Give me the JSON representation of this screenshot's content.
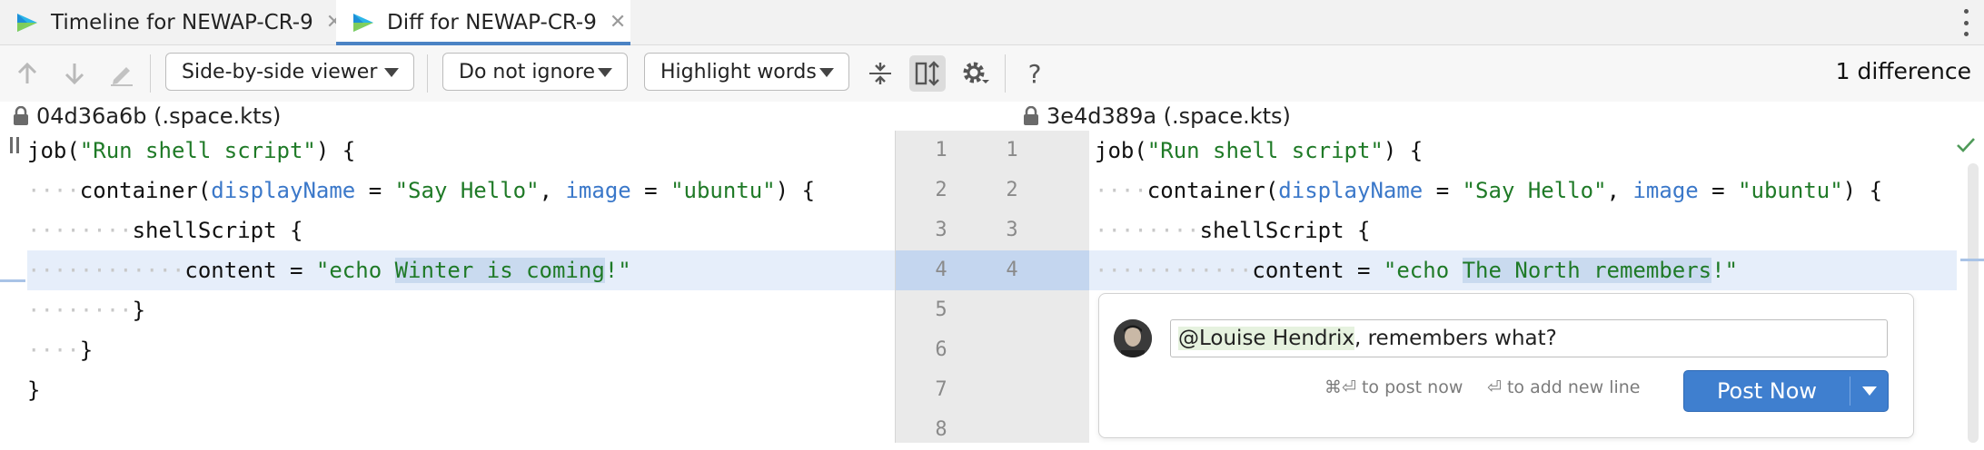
{
  "tabs": [
    {
      "label": "Timeline for NEWAP-CR-9",
      "active": false
    },
    {
      "label": "Diff for NEWAP-CR-9",
      "active": true
    }
  ],
  "toolbar": {
    "viewer_mode": "Side-by-side viewer",
    "ignore_mode": "Do not ignore",
    "highlight_mode": "Highlight words",
    "help_label": "?",
    "difference_count": "1 difference",
    "icons": [
      "arrow-up-icon",
      "arrow-down-icon",
      "edit-icon",
      "collapse-unchanged-icon",
      "sync-scroll-icon",
      "gear-icon",
      "help-icon"
    ]
  },
  "left_pane": {
    "file_label": "04d36a6b (.space.kts)",
    "lines": [
      {
        "indent": "",
        "tokens": [
          {
            "t": "job(",
            "c": ""
          },
          {
            "t": "\"Run shell script\"",
            "c": "str"
          },
          {
            "t": ") {",
            "c": ""
          }
        ]
      },
      {
        "indent": "····",
        "tokens": [
          {
            "t": "container(",
            "c": ""
          },
          {
            "t": "displayName",
            "c": "key"
          },
          {
            "t": " = ",
            "c": ""
          },
          {
            "t": "\"Say Hello\"",
            "c": "str"
          },
          {
            "t": ", ",
            "c": ""
          },
          {
            "t": "image",
            "c": "key"
          },
          {
            "t": " = ",
            "c": ""
          },
          {
            "t": "\"ubuntu\"",
            "c": "str"
          },
          {
            "t": ") {",
            "c": ""
          }
        ]
      },
      {
        "indent": "········",
        "tokens": [
          {
            "t": "shellScript {",
            "c": ""
          }
        ]
      },
      {
        "indent": "············",
        "tokens": [
          {
            "t": "content = ",
            "c": ""
          },
          {
            "t": "\"echo ",
            "c": "str"
          },
          {
            "t": "Winter is coming",
            "c": "str hl"
          },
          {
            "t": "!\"",
            "c": "str"
          }
        ],
        "changed": true
      },
      {
        "indent": "········",
        "tokens": [
          {
            "t": "}",
            "c": ""
          }
        ]
      },
      {
        "indent": "····",
        "tokens": [
          {
            "t": "}",
            "c": ""
          }
        ]
      },
      {
        "indent": "",
        "tokens": [
          {
            "t": "}",
            "c": ""
          }
        ]
      }
    ]
  },
  "right_pane": {
    "file_label": "3e4d389a (.space.kts)",
    "lines": [
      {
        "indent": "",
        "tokens": [
          {
            "t": "job(",
            "c": ""
          },
          {
            "t": "\"Run shell script\"",
            "c": "str"
          },
          {
            "t": ") {",
            "c": ""
          }
        ]
      },
      {
        "indent": "····",
        "tokens": [
          {
            "t": "container(",
            "c": ""
          },
          {
            "t": "displayName",
            "c": "key"
          },
          {
            "t": " = ",
            "c": ""
          },
          {
            "t": "\"Say Hello\"",
            "c": "str"
          },
          {
            "t": ", ",
            "c": ""
          },
          {
            "t": "image",
            "c": "key"
          },
          {
            "t": " = ",
            "c": ""
          },
          {
            "t": "\"ubuntu\"",
            "c": "str"
          },
          {
            "t": ") {",
            "c": ""
          }
        ]
      },
      {
        "indent": "········",
        "tokens": [
          {
            "t": "shellScript {",
            "c": ""
          }
        ]
      },
      {
        "indent": "············",
        "tokens": [
          {
            "t": "content = ",
            "c": ""
          },
          {
            "t": "\"echo ",
            "c": "str"
          },
          {
            "t": "The North remembers",
            "c": "str hl"
          },
          {
            "t": "!\"",
            "c": "str"
          }
        ],
        "changed": true
      }
    ]
  },
  "gutter": {
    "left_numbers": [
      "1",
      "2",
      "3",
      "4",
      "5",
      "6",
      "7",
      "8"
    ],
    "right_numbers": [
      "1",
      "2",
      "3",
      "4"
    ]
  },
  "comment": {
    "mention": "@Louise Hendrix",
    "text": ", remembers what?",
    "hint_post": "⌘⏎ to post now",
    "hint_newline": "⏎ to add new line",
    "post_button": "Post Now"
  },
  "colors": {
    "accent": "#3f7fcf",
    "string": "#1f7a27",
    "keyword": "#3b78c9",
    "changed_line": "#e6eefa",
    "word_highlight": "#c9daef"
  }
}
